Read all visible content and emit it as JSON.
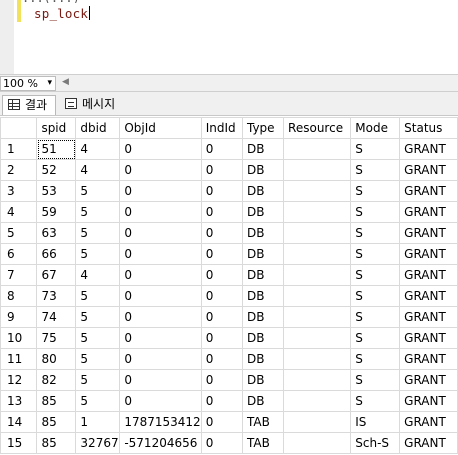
{
  "editor": {
    "partial_top_text": "                                   ...(...)",
    "code_line": "sp_lock"
  },
  "zoom": {
    "value": "100 %"
  },
  "tabs": [
    {
      "label": "결과",
      "icon": "grid-icon"
    },
    {
      "label": "메시지",
      "icon": "message-icon"
    }
  ],
  "grid": {
    "columns": [
      "spid",
      "dbid",
      "ObjId",
      "IndId",
      "Type",
      "Resource",
      "Mode",
      "Status"
    ],
    "rows": [
      [
        "1",
        "51",
        "4",
        "0",
        "0",
        "DB",
        "",
        "S",
        "GRANT"
      ],
      [
        "2",
        "52",
        "4",
        "0",
        "0",
        "DB",
        "",
        "S",
        "GRANT"
      ],
      [
        "3",
        "53",
        "5",
        "0",
        "0",
        "DB",
        "",
        "S",
        "GRANT"
      ],
      [
        "4",
        "59",
        "5",
        "0",
        "0",
        "DB",
        "",
        "S",
        "GRANT"
      ],
      [
        "5",
        "63",
        "5",
        "0",
        "0",
        "DB",
        "",
        "S",
        "GRANT"
      ],
      [
        "6",
        "66",
        "5",
        "0",
        "0",
        "DB",
        "",
        "S",
        "GRANT"
      ],
      [
        "7",
        "67",
        "4",
        "0",
        "0",
        "DB",
        "",
        "S",
        "GRANT"
      ],
      [
        "8",
        "73",
        "5",
        "0",
        "0",
        "DB",
        "",
        "S",
        "GRANT"
      ],
      [
        "9",
        "74",
        "5",
        "0",
        "0",
        "DB",
        "",
        "S",
        "GRANT"
      ],
      [
        "10",
        "75",
        "5",
        "0",
        "0",
        "DB",
        "",
        "S",
        "GRANT"
      ],
      [
        "11",
        "80",
        "5",
        "0",
        "0",
        "DB",
        "",
        "S",
        "GRANT"
      ],
      [
        "12",
        "82",
        "5",
        "0",
        "0",
        "DB",
        "",
        "S",
        "GRANT"
      ],
      [
        "13",
        "85",
        "5",
        "0",
        "0",
        "DB",
        "",
        "S",
        "GRANT"
      ],
      [
        "14",
        "85",
        "1",
        "1787153412",
        "0",
        "TAB",
        "",
        "IS",
        "GRANT"
      ],
      [
        "15",
        "85",
        "32767",
        "-571204656",
        "0",
        "TAB",
        "",
        "Sch-S",
        "GRANT"
      ]
    ]
  }
}
